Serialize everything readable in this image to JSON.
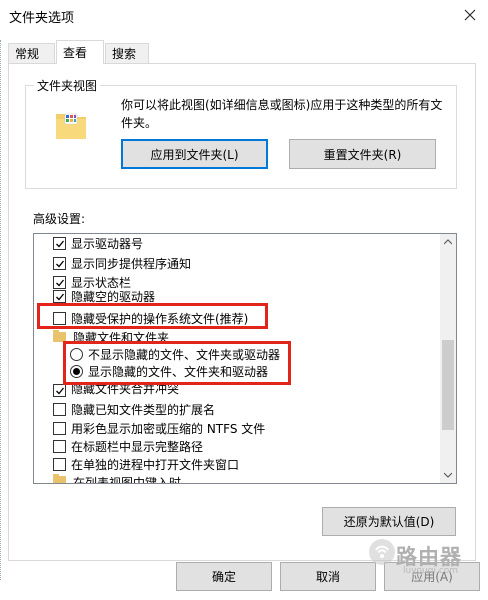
{
  "window": {
    "title": "文件夹选项"
  },
  "tabs": [
    {
      "label": "常规"
    },
    {
      "label": "查看"
    },
    {
      "label": "搜索"
    }
  ],
  "folder_views": {
    "title": "文件夹视图",
    "description": "你可以将此视图(如详细信息或图标)应用于这种类型的所有文件夹。",
    "apply_button": "应用到文件夹(L)",
    "reset_button": "重置文件夹(R)"
  },
  "advanced": {
    "label": "高级设置:",
    "items": [
      {
        "label": "显示驱动器号",
        "type": "checkbox",
        "checked": true
      },
      {
        "label": "显示同步提供程序通知",
        "type": "checkbox",
        "checked": true
      },
      {
        "label": "显示状态栏",
        "type": "checkbox",
        "checked": true
      },
      {
        "label": "隐藏空的驱动器",
        "type": "checkbox",
        "checked": true
      },
      {
        "label": "隐藏受保护的操作系统文件(推荐)",
        "type": "checkbox",
        "checked": false
      },
      {
        "label": "隐藏文件和文件夹",
        "type": "folder"
      },
      {
        "label": "不显示隐藏的文件、文件夹或驱动器",
        "type": "radio",
        "selected": false
      },
      {
        "label": "显示隐藏的文件、文件夹和驱动器",
        "type": "radio",
        "selected": true
      },
      {
        "label": "隐藏文件夹合并冲突",
        "type": "checkbox",
        "checked": true
      },
      {
        "label": "隐藏已知文件类型的扩展名",
        "type": "checkbox",
        "checked": false
      },
      {
        "label": "用彩色显示加密或压缩的 NTFS 文件",
        "type": "checkbox",
        "checked": false
      },
      {
        "label": "在标题栏中显示完整路径",
        "type": "checkbox",
        "checked": false
      },
      {
        "label": "在单独的进程中打开文件夹窗口",
        "type": "checkbox",
        "checked": false
      },
      {
        "label": "在列表视图中键入时",
        "type": "folder"
      }
    ],
    "restore_button": "还原为默认值(D)"
  },
  "footer": {
    "ok": "确定",
    "cancel": "取消",
    "apply": "应用(A)"
  },
  "watermark": {
    "text": "路由器",
    "sub": "luyouqi.com"
  },
  "colors": {
    "highlight": "#e1251b",
    "accent": "#0078d7"
  }
}
